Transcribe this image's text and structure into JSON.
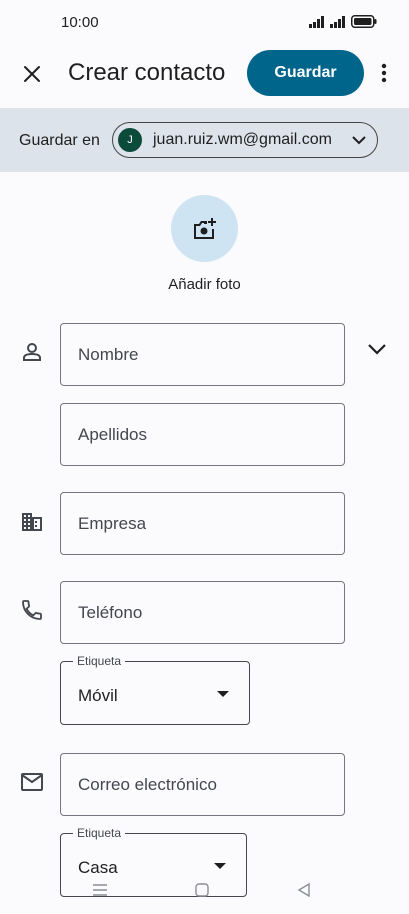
{
  "status_bar": {
    "time": "10:00"
  },
  "app_bar": {
    "title": "Crear contacto",
    "save_label": "Guardar"
  },
  "account": {
    "label": "Guardar en",
    "avatar_letter": "J",
    "email": "juan.ruiz.wm@gmail.com",
    "avatar_color": "#0c4a3a"
  },
  "photo": {
    "label": "Añadir foto"
  },
  "fields": {
    "first_name": "Nombre",
    "last_name": "Apellidos",
    "company": "Empresa",
    "phone": "Teléfono",
    "phone_label": {
      "caption": "Etiqueta",
      "value": "Móvil"
    },
    "email": "Correo electrónico",
    "email_label": {
      "caption": "Etiqueta",
      "value": "Casa"
    }
  },
  "colors": {
    "accent": "#00658b",
    "account_bar": "#dde3ea",
    "photo_bg": "#cfe4f2"
  }
}
